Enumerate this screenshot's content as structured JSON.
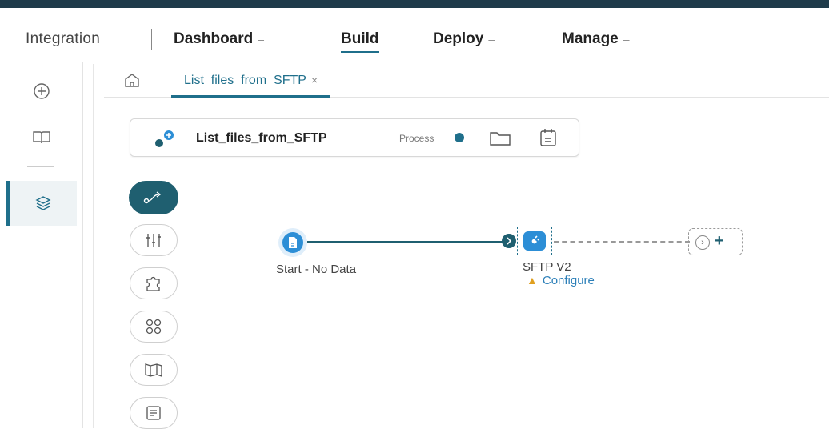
{
  "nav": {
    "brand": "Integration",
    "items": [
      {
        "label": "Dashboard",
        "caret": "–"
      },
      {
        "label": "Build"
      },
      {
        "label": "Deploy",
        "caret": "–"
      },
      {
        "label": "Manage",
        "caret": "–"
      }
    ],
    "active_item": "Build"
  },
  "tabs": {
    "home_icon": "home-icon",
    "open_tab": {
      "label": "List_files_from_SFTP",
      "close": "×"
    }
  },
  "process_header": {
    "name": "List_files_from_SFTP",
    "type_label": "Process",
    "icons": [
      "process-icon",
      "info-icon",
      "folder-icon",
      "calendar-icon"
    ]
  },
  "left_rail": {
    "icons": [
      "add-circle-icon",
      "book-icon",
      "layers-icon"
    ],
    "active": "layers-icon"
  },
  "palette": {
    "icons": [
      "connector-shape-icon",
      "sliders-icon",
      "puzzle-icon",
      "apps-grid-icon",
      "map-icon",
      "notes-icon"
    ]
  },
  "canvas": {
    "start_node": {
      "label": "Start - No Data"
    },
    "sftp_node": {
      "label": "SFTP V2",
      "status": "Configure"
    },
    "add_node": {
      "symbol": "+"
    }
  },
  "colors": {
    "accent": "#1f6f8b",
    "dark_accent": "#1f5f70",
    "node_blue": "#2c8ed6",
    "warning": "#e0a020",
    "top_bar": "#1f3b4a"
  }
}
